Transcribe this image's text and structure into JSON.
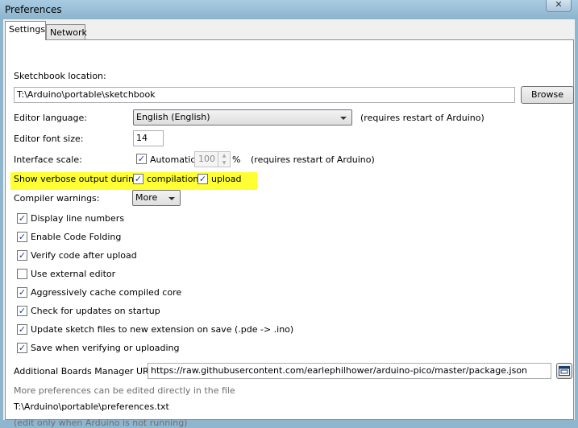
{
  "window": {
    "title": "Preferences",
    "close_glyph": "✕"
  },
  "tabs": [
    {
      "label": "Settings"
    },
    {
      "label": "Network"
    }
  ],
  "sketchbook": {
    "label": "Sketchbook location:",
    "value": "T:\\Arduino\\portable\\sketchbook",
    "browse_label": "Browse"
  },
  "language": {
    "label": "Editor language:",
    "value": "English (English)",
    "note": "(requires restart of Arduino)"
  },
  "font_size": {
    "label": "Editor font size:",
    "value": "14"
  },
  "scale": {
    "label": "Interface scale:",
    "automatic_label": "Automatic",
    "automatic_checked": true,
    "value": "100",
    "unit": "%",
    "note": "(requires restart of Arduino)"
  },
  "verbose": {
    "label": "Show verbose output during:",
    "compilation_label": "compilation",
    "compilation_checked": true,
    "upload_label": "upload",
    "upload_checked": true,
    "highlight_color": "#ffff34"
  },
  "warnings": {
    "label": "Compiler warnings:",
    "value": "More"
  },
  "options": [
    {
      "label": "Display line numbers",
      "checked": true
    },
    {
      "label": "Enable Code Folding",
      "checked": true
    },
    {
      "label": "Verify code after upload",
      "checked": true
    },
    {
      "label": "Use external editor",
      "checked": false
    },
    {
      "label": "Aggressively cache compiled core",
      "checked": true
    },
    {
      "label": "Check for updates on startup",
      "checked": true
    },
    {
      "label": "Update sketch files to new extension on save (.pde -> .ino)",
      "checked": true
    },
    {
      "label": "Save when verifying or uploading",
      "checked": true
    }
  ],
  "boards": {
    "label": "Additional Boards Manager URLs:",
    "value": "https://raw.githubusercontent.com/earlephilhower/arduino-pico/master/package.json"
  },
  "footer": {
    "more_prefs": "More preferences can be edited directly in the file",
    "path": "T:\\Arduino\\portable\\preferences.txt",
    "note": "(edit only when Arduino is not running)"
  },
  "icons": {
    "checkmark": "✓",
    "list_button": "window-list-icon"
  }
}
